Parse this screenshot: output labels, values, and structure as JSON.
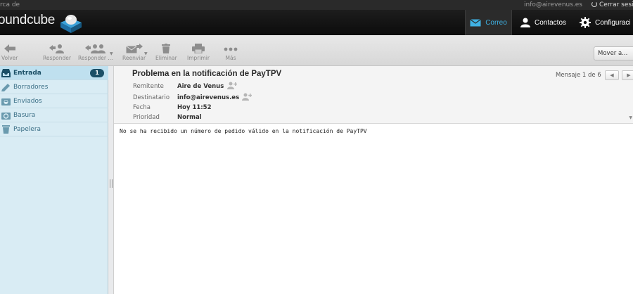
{
  "topbar": {
    "about": "rca de",
    "user": "info@airevenus.es",
    "logout": "Cerrar sesi"
  },
  "header": {
    "logo": "oundcube",
    "nav": {
      "mail": "Correo",
      "contacts": "Contactos",
      "settings": "Configuraci"
    }
  },
  "toolbar": {
    "back": "Volver",
    "reply": "Responder",
    "reply_all": "Responder ...",
    "forward": "Reenviar",
    "delete": "Eliminar",
    "print": "Imprimir",
    "more": "Más",
    "move_to": "Mover a..."
  },
  "folders": [
    {
      "label": "Entrada",
      "unread": "1",
      "icon": "inbox-icon"
    },
    {
      "label": "Borradores",
      "icon": "pencil-icon"
    },
    {
      "label": "Enviados",
      "icon": "sent-icon"
    },
    {
      "label": "Basura",
      "icon": "junk-icon"
    },
    {
      "label": "Papelera",
      "icon": "trash-icon"
    }
  ],
  "message": {
    "subject": "Problema en la notificación de PayTPV",
    "counter": "Mensaje 1 de 6",
    "headers": {
      "from_label": "Remitente",
      "from": "Aire de Venus",
      "to_label": "Destinatario",
      "to": "info@airevenus.es",
      "date_label": "Fecha",
      "date": "Hoy 11:52",
      "priority_label": "Prioridad",
      "priority": "Normal"
    },
    "body": "No se ha recibido un número de pedido válido en la notificación de PayTPV"
  },
  "colors": {
    "accent": "#3fb1e3",
    "sidebar": "#d9ecf4",
    "header": "#111111"
  }
}
